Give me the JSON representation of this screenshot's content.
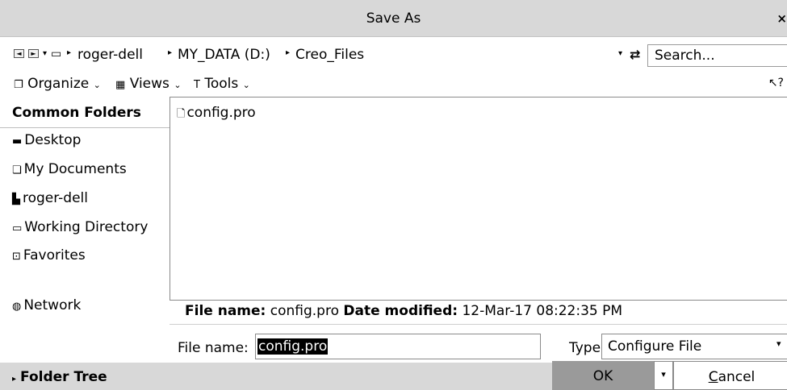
{
  "window": {
    "title": "Save As",
    "close_icon": "×"
  },
  "address": {
    "crumbs": [
      "roger-dell",
      "MY_DATA (D:)",
      "Creo_Files"
    ],
    "search_placeholder": "Search..."
  },
  "toolbar": {
    "organize": "Organize",
    "views": "Views",
    "tools": "Tools"
  },
  "sidebar": {
    "heading": "Common Folders",
    "items": [
      {
        "label": "Desktop",
        "icon": "desktop-icon"
      },
      {
        "label": "My Documents",
        "icon": "documents-icon"
      },
      {
        "label": "roger-dell",
        "icon": "computer-icon"
      },
      {
        "label": "Working Directory",
        "icon": "working-directory-icon"
      },
      {
        "label": "Favorites",
        "icon": "favorites-icon"
      },
      {
        "label": "Network",
        "icon": "network-icon"
      }
    ],
    "folder_tree": "Folder Tree"
  },
  "files": [
    {
      "name": "config.pro"
    }
  ],
  "info": {
    "file_name_label": "File name:",
    "file_name_value": "config.pro",
    "date_label": "Date modified:",
    "date_value": "12-Mar-17 08:22:35 PM"
  },
  "form": {
    "file_name_label": "File name:",
    "file_name_value": "config.pro",
    "type_label": "Type",
    "type_value": "Configure File"
  },
  "buttons": {
    "ok": "OK",
    "cancel_underlined": "C",
    "cancel_rest": "ancel"
  }
}
